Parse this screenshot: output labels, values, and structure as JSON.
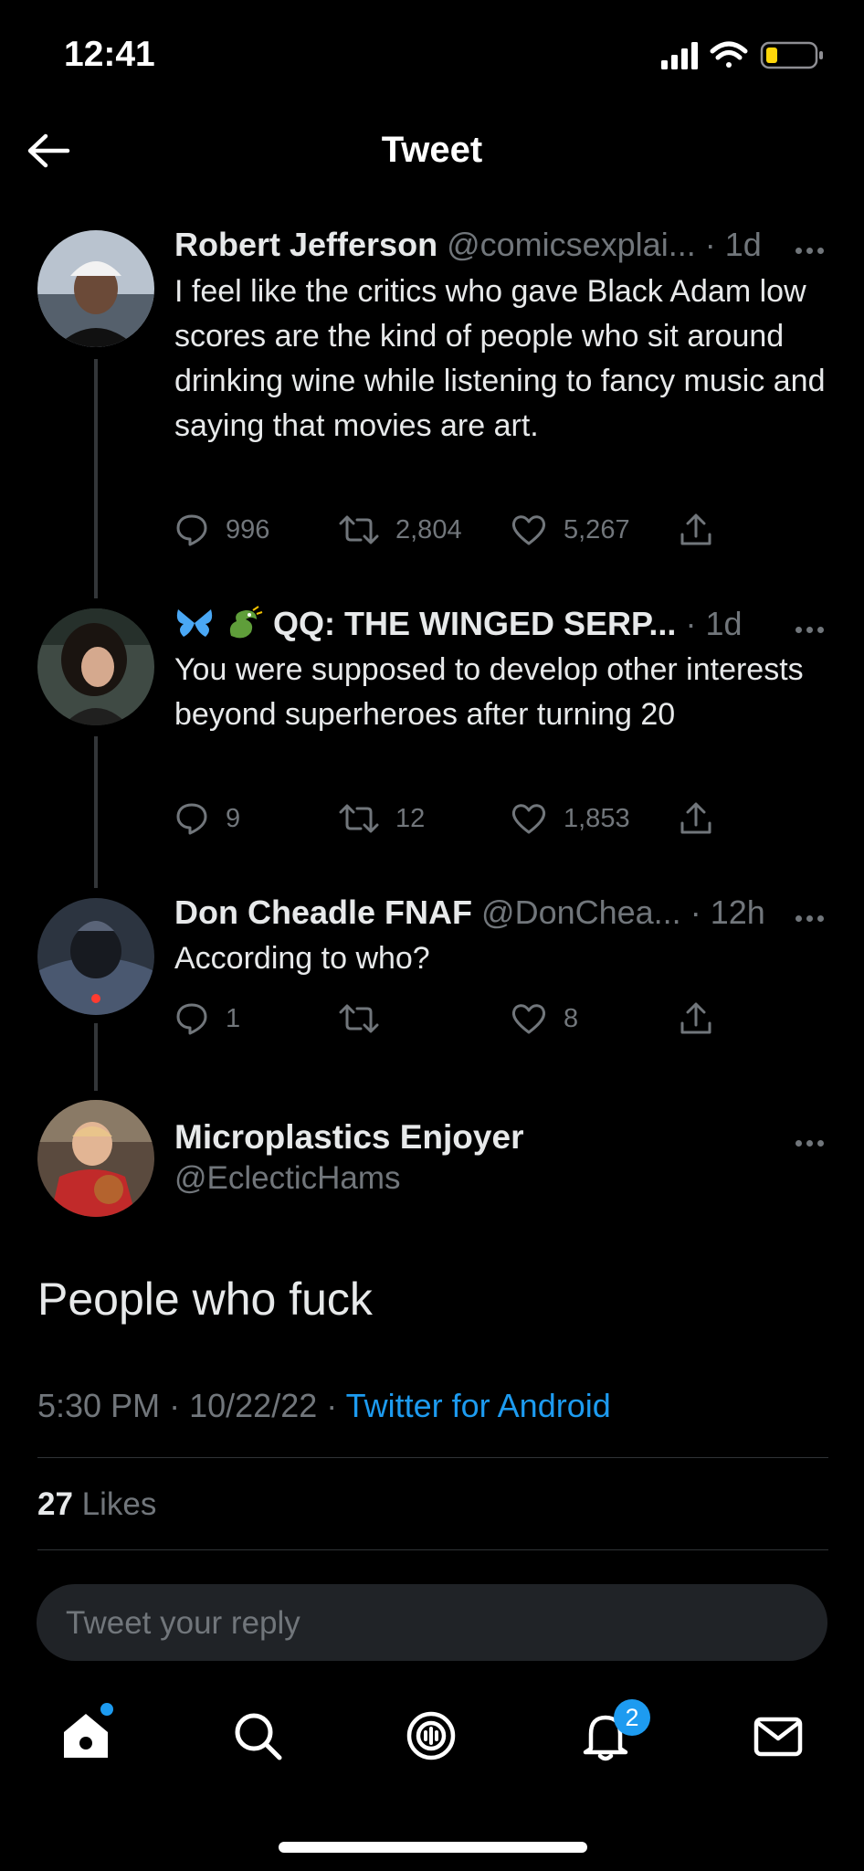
{
  "status_bar": {
    "time": "12:41"
  },
  "header": {
    "title": "Tweet"
  },
  "tweets": [
    {
      "name": "Robert Jefferson",
      "handle": "@comicsexplai...",
      "separator": "·",
      "time": "1d",
      "text": "I feel like the critics who gave Black Adam low scores are the kind of people who sit around drinking wine while listening to fancy music and saying that movies are art.",
      "replies": "996",
      "retweets": "2,804",
      "likes": "5,267"
    },
    {
      "name_prefix_icons": [
        "butterfly-icon",
        "dragon-icon"
      ],
      "name": "QQ: THE WINGED SERP...",
      "separator": "·",
      "time": "1d",
      "text": "You were supposed to develop other interests beyond superheroes after turning 20",
      "replies": "9",
      "retweets": "12",
      "likes": "1,853"
    },
    {
      "name": "Don Cheadle FNAF",
      "handle": "@DonChea...",
      "separator": "·",
      "time": "12h",
      "text": "According to who?",
      "replies": "1",
      "retweets": "",
      "likes": "8"
    }
  ],
  "main_tweet": {
    "name": "Microplastics Enjoyer",
    "handle": "@EclecticHams",
    "text": "People who fuck",
    "time": "5:30 PM",
    "date": "10/22/22",
    "separator": "·",
    "source": "Twitter for Android",
    "likes_count": "27",
    "likes_label": "Likes"
  },
  "reply_box": {
    "placeholder": "Tweet your reply"
  },
  "bottom_nav": {
    "items": [
      "home-icon",
      "search-icon",
      "spaces-icon",
      "notifications-icon",
      "messages-icon"
    ],
    "notifications_badge": "2"
  },
  "colors": {
    "accent": "#1d9bf0",
    "background": "#000000",
    "muted": "#71767b"
  }
}
